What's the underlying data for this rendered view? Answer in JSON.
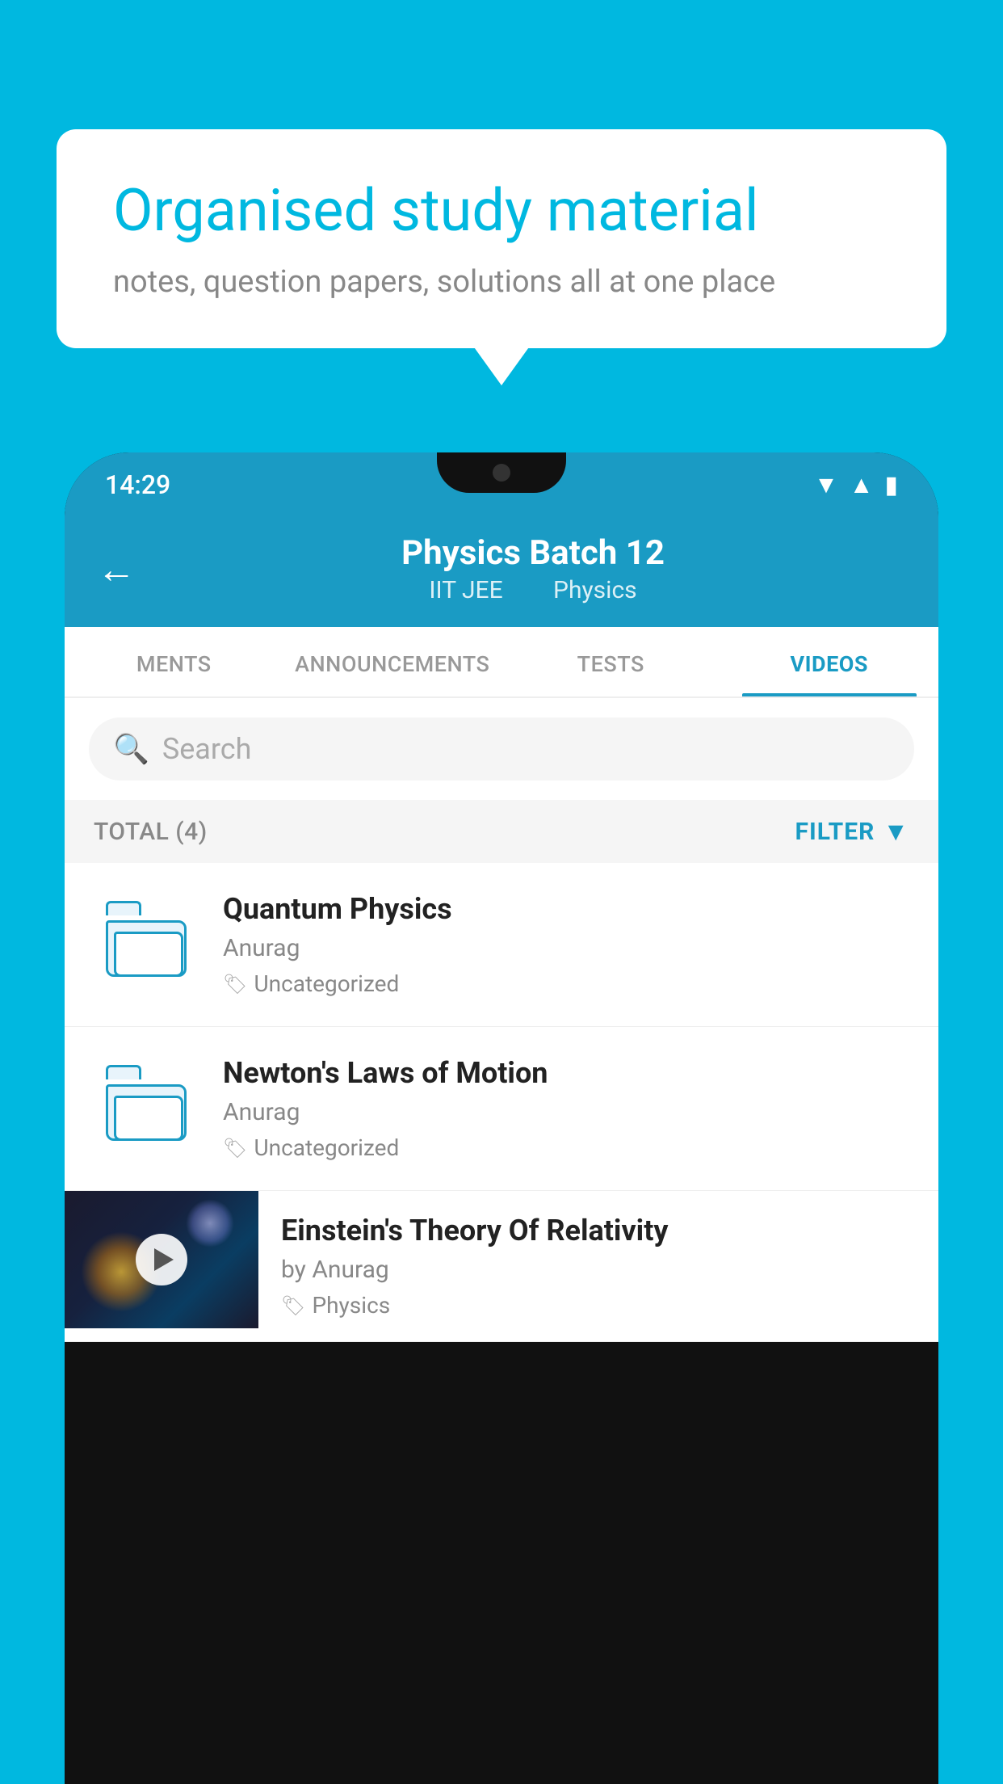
{
  "background_color": "#00B8E0",
  "bubble": {
    "title": "Organised study material",
    "subtitle": "notes, question papers, solutions all at one place"
  },
  "phone": {
    "status_bar": {
      "time": "14:29",
      "icons": [
        "wifi",
        "signal",
        "battery"
      ]
    },
    "header": {
      "back_label": "←",
      "title": "Physics Batch 12",
      "subtitle_part1": "IIT JEE",
      "subtitle_part2": "Physics"
    },
    "tabs": [
      {
        "label": "MENTS",
        "active": false
      },
      {
        "label": "ANNOUNCEMENTS",
        "active": false
      },
      {
        "label": "TESTS",
        "active": false
      },
      {
        "label": "VIDEOS",
        "active": true
      }
    ],
    "search": {
      "placeholder": "Search"
    },
    "filter_bar": {
      "total_label": "TOTAL (4)",
      "filter_label": "FILTER"
    },
    "videos": [
      {
        "title": "Quantum Physics",
        "author": "Anurag",
        "tag": "Uncategorized",
        "has_thumbnail": false
      },
      {
        "title": "Newton's Laws of Motion",
        "author": "Anurag",
        "tag": "Uncategorized",
        "has_thumbnail": false
      },
      {
        "title": "Einstein's Theory Of Relativity",
        "author": "by Anurag",
        "tag": "Physics",
        "has_thumbnail": true
      }
    ]
  }
}
